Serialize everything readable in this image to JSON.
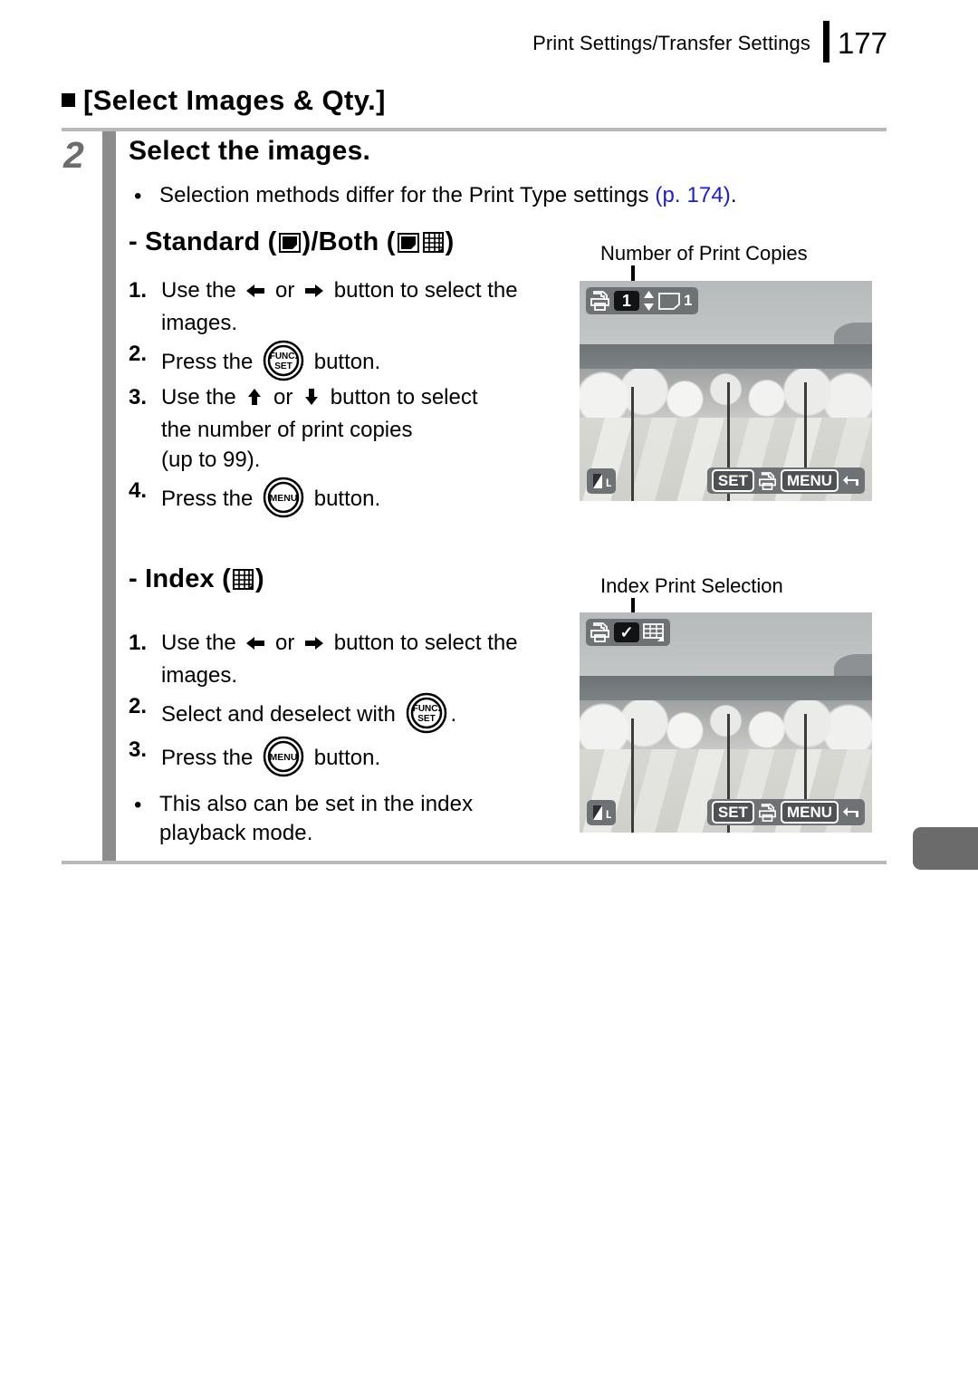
{
  "header": {
    "title": "Print Settings/Transfer Settings",
    "page_number": "177"
  },
  "section": {
    "title": "[Select Images & Qty.]",
    "step_number": "2",
    "step_heading": "Select the images.",
    "intro_bullet_before": "Selection methods differ for the Print Type settings ",
    "intro_bullet_link": "(p. 174)",
    "intro_bullet_after": "."
  },
  "standard": {
    "heading_prefix": "- Standard (",
    "heading_middle": ")/Both (",
    "heading_suffix": ")",
    "steps": [
      {
        "num": "1.",
        "text_a": "Use the ",
        "text_b": " or ",
        "text_c": " button to select the",
        "cont": "images."
      },
      {
        "num": "2.",
        "text_a": "Press the ",
        "text_c": " button."
      },
      {
        "num": "3.",
        "text_a": "Use the ",
        "text_b": " or ",
        "text_c": " button to select",
        "cont": "the number of print copies",
        "cont2": "(up to 99)."
      },
      {
        "num": "4.",
        "text_a": "Press the ",
        "text_c": " button."
      }
    ]
  },
  "index": {
    "heading_prefix": "- Index (",
    "heading_suffix": ")",
    "steps": [
      {
        "num": "1.",
        "text_a": "Use the ",
        "text_b": " or ",
        "text_c": " button to select the",
        "cont": "images."
      },
      {
        "num": "2.",
        "text_a": "Select and deselect with ",
        "text_c": "."
      },
      {
        "num": "3.",
        "text_a": "Press the ",
        "text_c": " button."
      }
    ],
    "note": "This also can be set in the index playback mode."
  },
  "screens": {
    "standard": {
      "callout": "Number of Print Copies",
      "copies_value": "1",
      "image_count": "1",
      "quality_label": "L",
      "set_key": "SET",
      "menu_key": "MENU"
    },
    "index": {
      "callout": "Index Print Selection",
      "check_mark": "✓",
      "quality_label": "L",
      "set_key": "SET",
      "menu_key": "MENU"
    }
  },
  "icons": {
    "printer": "printer-icon",
    "photo": "photo-icon",
    "grid": "grid-icon",
    "back_arrow": "back-arrow-icon",
    "updown": "up-down-arrows-icon",
    "func_set_line1": "FUNC.",
    "func_set_line2": "SET",
    "menu_label": "MENU"
  },
  "colors": {
    "link": "#1a1ae0",
    "rule": "#b9b9b9",
    "step_bar": "#8c8c8c",
    "step_number": "#6d6d6d",
    "osd_bg": "#6f7274",
    "edge_tab": "#6b6b6b"
  }
}
